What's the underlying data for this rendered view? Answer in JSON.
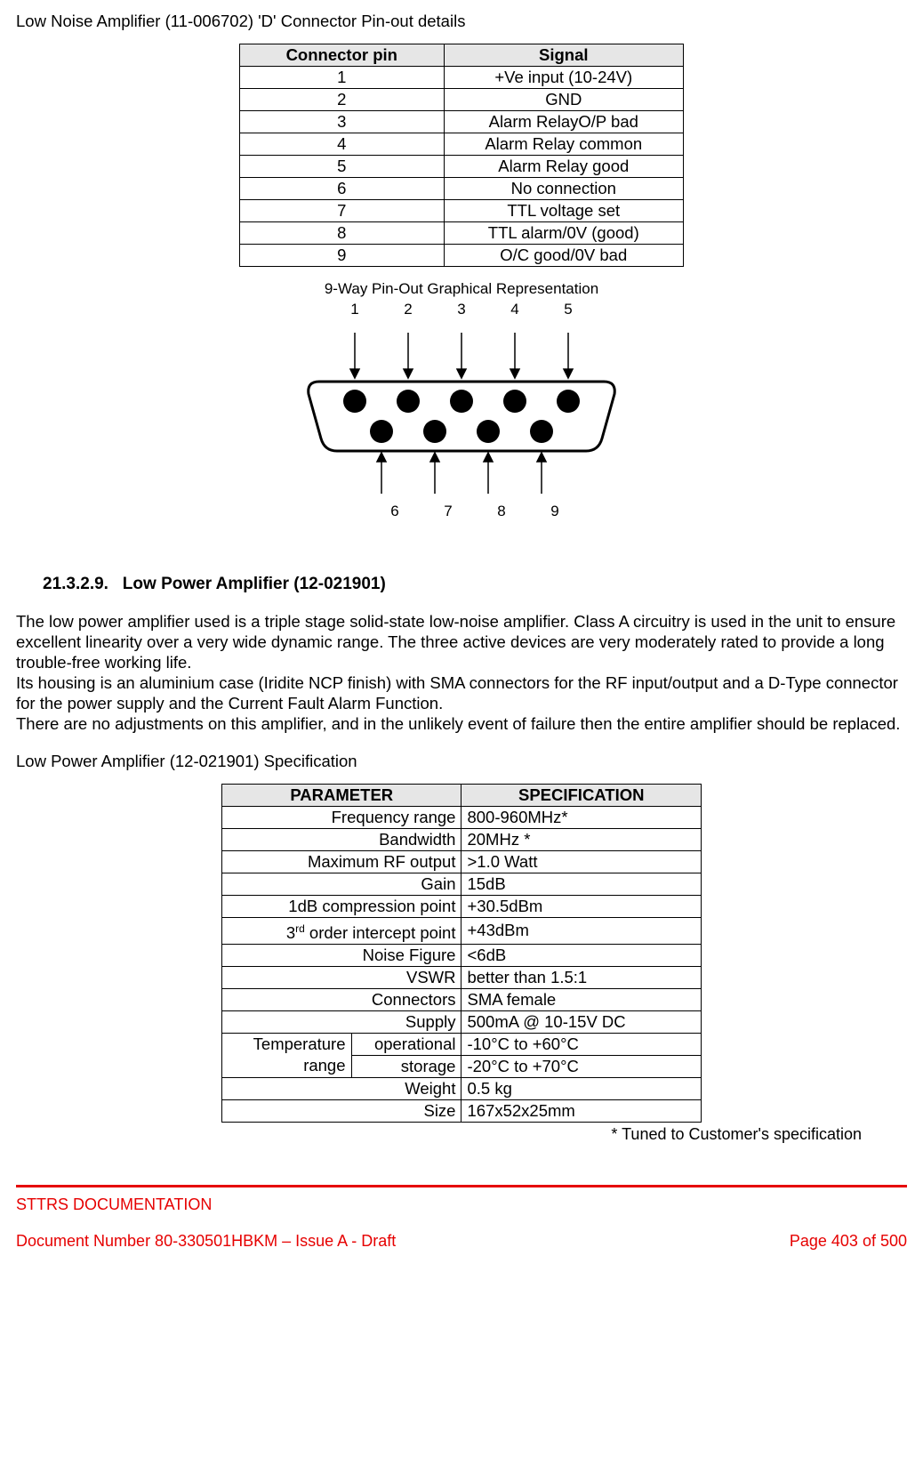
{
  "title_line": "Low Noise Amplifier (11-006702) 'D' Connector Pin-out details",
  "pinout": {
    "headers": {
      "pin": "Connector pin",
      "signal": "Signal"
    },
    "rows": [
      {
        "pin": "1",
        "signal": "+Ve input (10-24V)"
      },
      {
        "pin": "2",
        "signal": "GND"
      },
      {
        "pin": "3",
        "signal": "Alarm RelayO/P bad"
      },
      {
        "pin": "4",
        "signal": "Alarm Relay common"
      },
      {
        "pin": "5",
        "signal": "Alarm Relay good"
      },
      {
        "pin": "6",
        "signal": "No connection"
      },
      {
        "pin": "7",
        "signal": "TTL voltage set"
      },
      {
        "pin": "8",
        "signal": "TTL alarm/0V (good)"
      },
      {
        "pin": "9",
        "signal": "O/C good/0V bad"
      }
    ]
  },
  "diagram": {
    "caption": "9-Way Pin-Out Graphical Representation",
    "top_labels": [
      "1",
      "2",
      "3",
      "4",
      "5"
    ],
    "bottom_labels": [
      "6",
      "7",
      "8",
      "9"
    ]
  },
  "section": {
    "number": "21.3.2.9.",
    "title": "Low Power Amplifier (12-021901)"
  },
  "paragraphs": {
    "p1": "The low power amplifier used is a triple stage solid-state low-noise amplifier. Class A circuitry is used in the unit to ensure excellent linearity over a very wide dynamic range. The three active devices are very moderately rated to provide a long trouble-free working life.",
    "p2": "Its housing is an aluminium case (Iridite NCP finish) with SMA connectors for the RF input/output and a D-Type connector for the power supply and the Current Fault Alarm Function.",
    "p3": "There are no adjustments on this amplifier, and in the unlikely event of failure then the entire amplifier should be replaced."
  },
  "spec_title": "Low Power Amplifier (12-021901) Specification",
  "spec": {
    "headers": {
      "param": "PARAMETER",
      "value": "SPECIFICATION"
    },
    "rows": [
      {
        "param": "Frequency range",
        "value": "800-960MHz*"
      },
      {
        "param": "Bandwidth",
        "value": "20MHz *"
      },
      {
        "param": "Maximum RF output",
        "value": ">1.0 Watt"
      },
      {
        "param": "Gain",
        "value": "15dB"
      },
      {
        "param": "1dB compression point",
        "value": "+30.5dBm"
      },
      {
        "param_html": "3<sup class='ord'>rd</sup> order intercept point",
        "param": "3rd order intercept point",
        "value": "+43dBm"
      },
      {
        "param": "Noise Figure",
        "value": "<6dB"
      },
      {
        "param": "VSWR",
        "value": "better than 1.5:1"
      },
      {
        "param": "Connectors",
        "value": "SMA female"
      },
      {
        "param": "Supply",
        "value": "500mA @ 10-15V DC"
      }
    ],
    "temp": {
      "label": "Temperature range",
      "operational_label": "operational",
      "operational_value": "-10°C to +60°C",
      "storage_label": "storage",
      "storage_value": "-20°C to +70°C"
    },
    "tail": [
      {
        "param": "Weight",
        "value": "0.5 kg"
      },
      {
        "param": "Size",
        "value": "167x52x25mm"
      }
    ]
  },
  "footnote": "* Tuned to Customer's specification",
  "footer": {
    "doc_title": "STTRS DOCUMENTATION",
    "doc_number": "Document Number 80-330501HBKM – Issue A - Draft",
    "page": "Page 403 of 500"
  }
}
